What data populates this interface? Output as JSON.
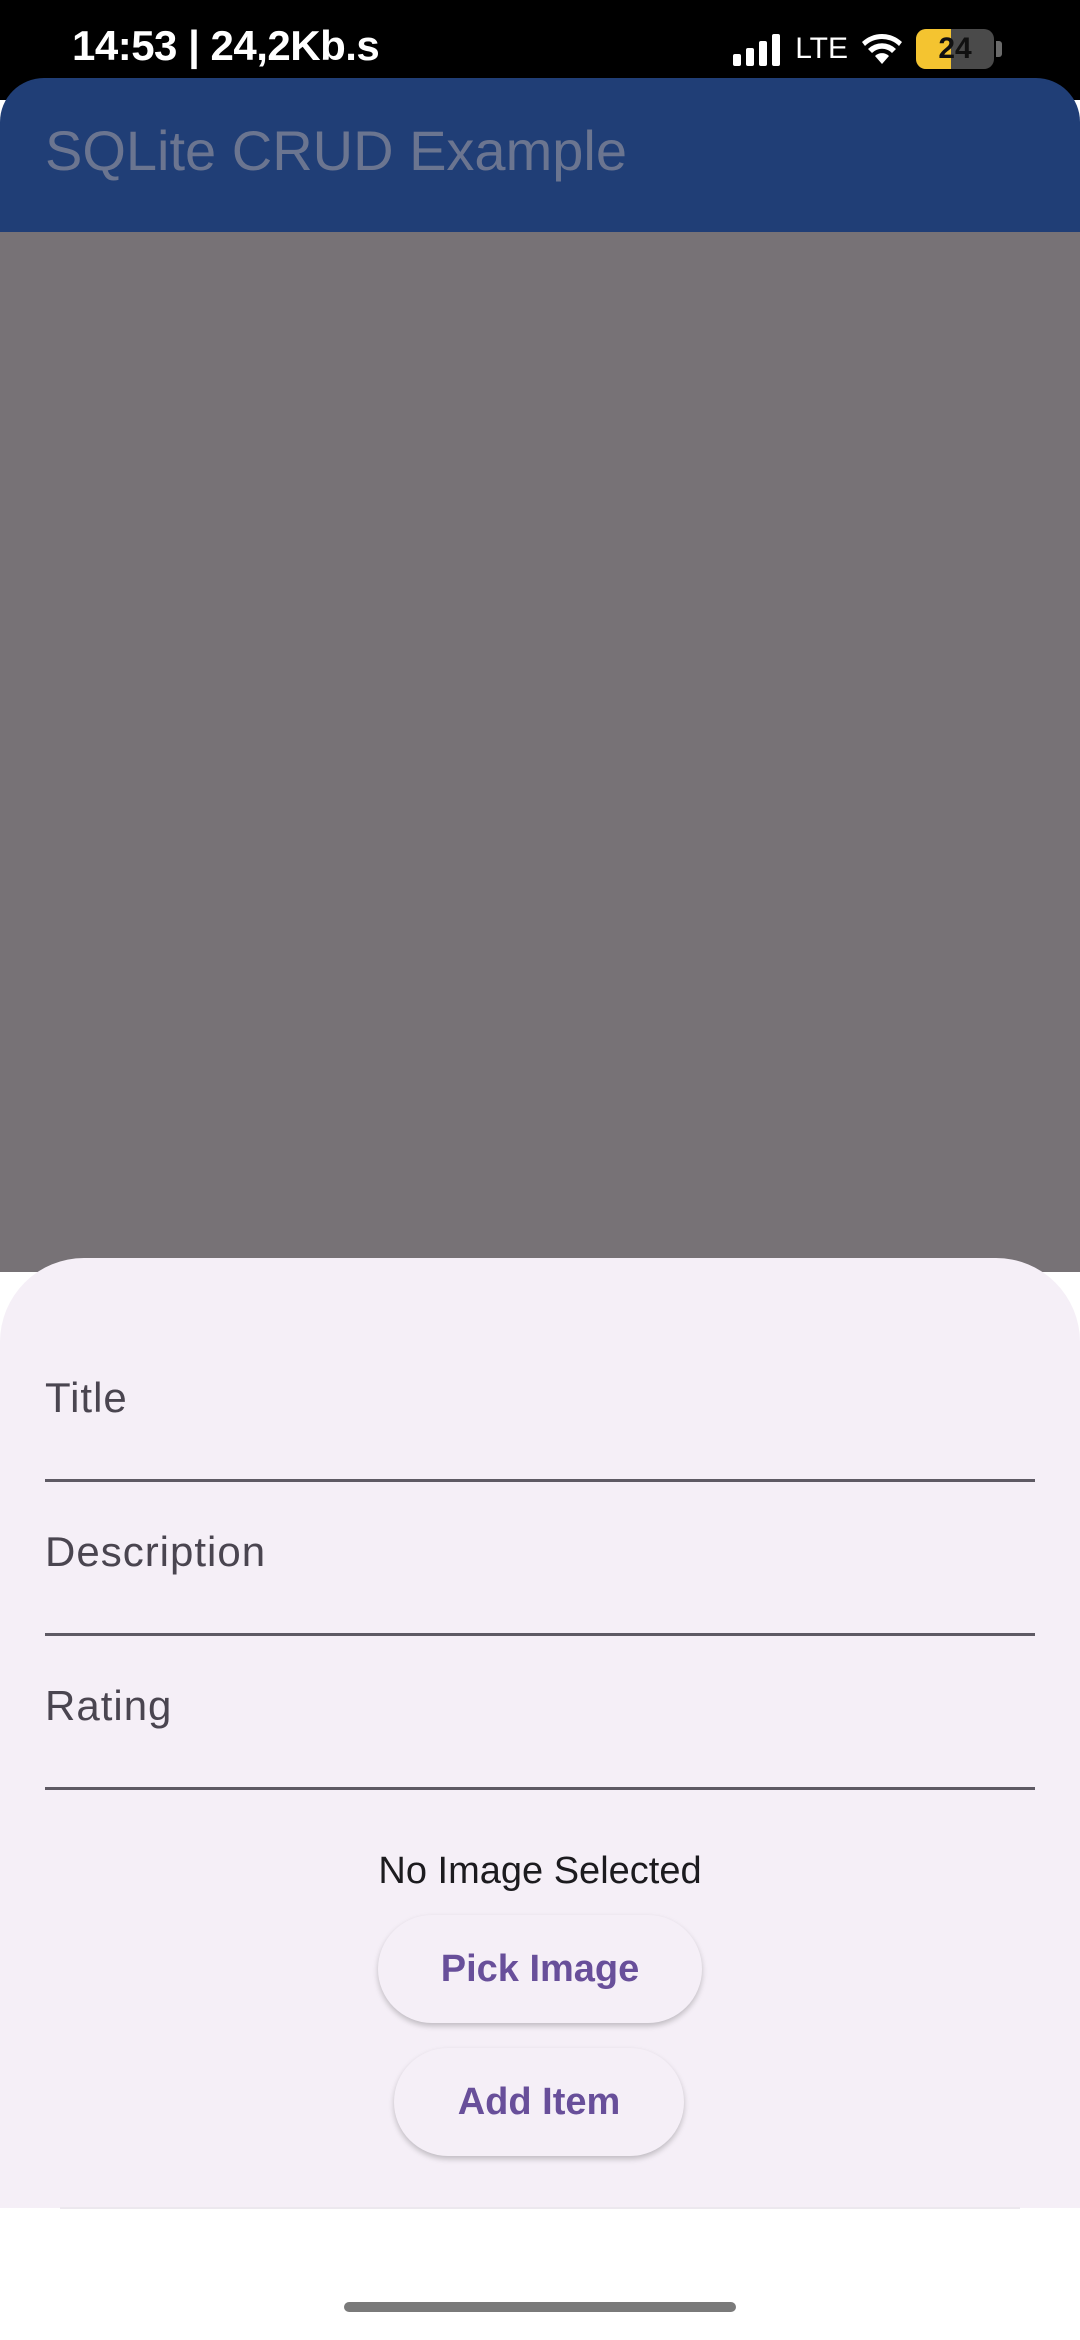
{
  "status_bar": {
    "time_and_speed": "14:53 | 24,2Kb.s",
    "network_type": "LTE",
    "battery_level": "24",
    "battery_fraction": 0.45,
    "icons": [
      "signal-icon",
      "wifi-icon",
      "battery-icon"
    ]
  },
  "app_bar": {
    "title": "SQLite CRUD Example",
    "background_color": "#203e76"
  },
  "sheet": {
    "fields": [
      {
        "label": "Title"
      },
      {
        "label": "Description"
      },
      {
        "label": "Rating"
      }
    ],
    "image_status": "No Image Selected",
    "pick_image_label": "Pick Image",
    "add_item_label": "Add Item",
    "accent_color": "#684f9a",
    "background_color": "#f5eff7"
  }
}
